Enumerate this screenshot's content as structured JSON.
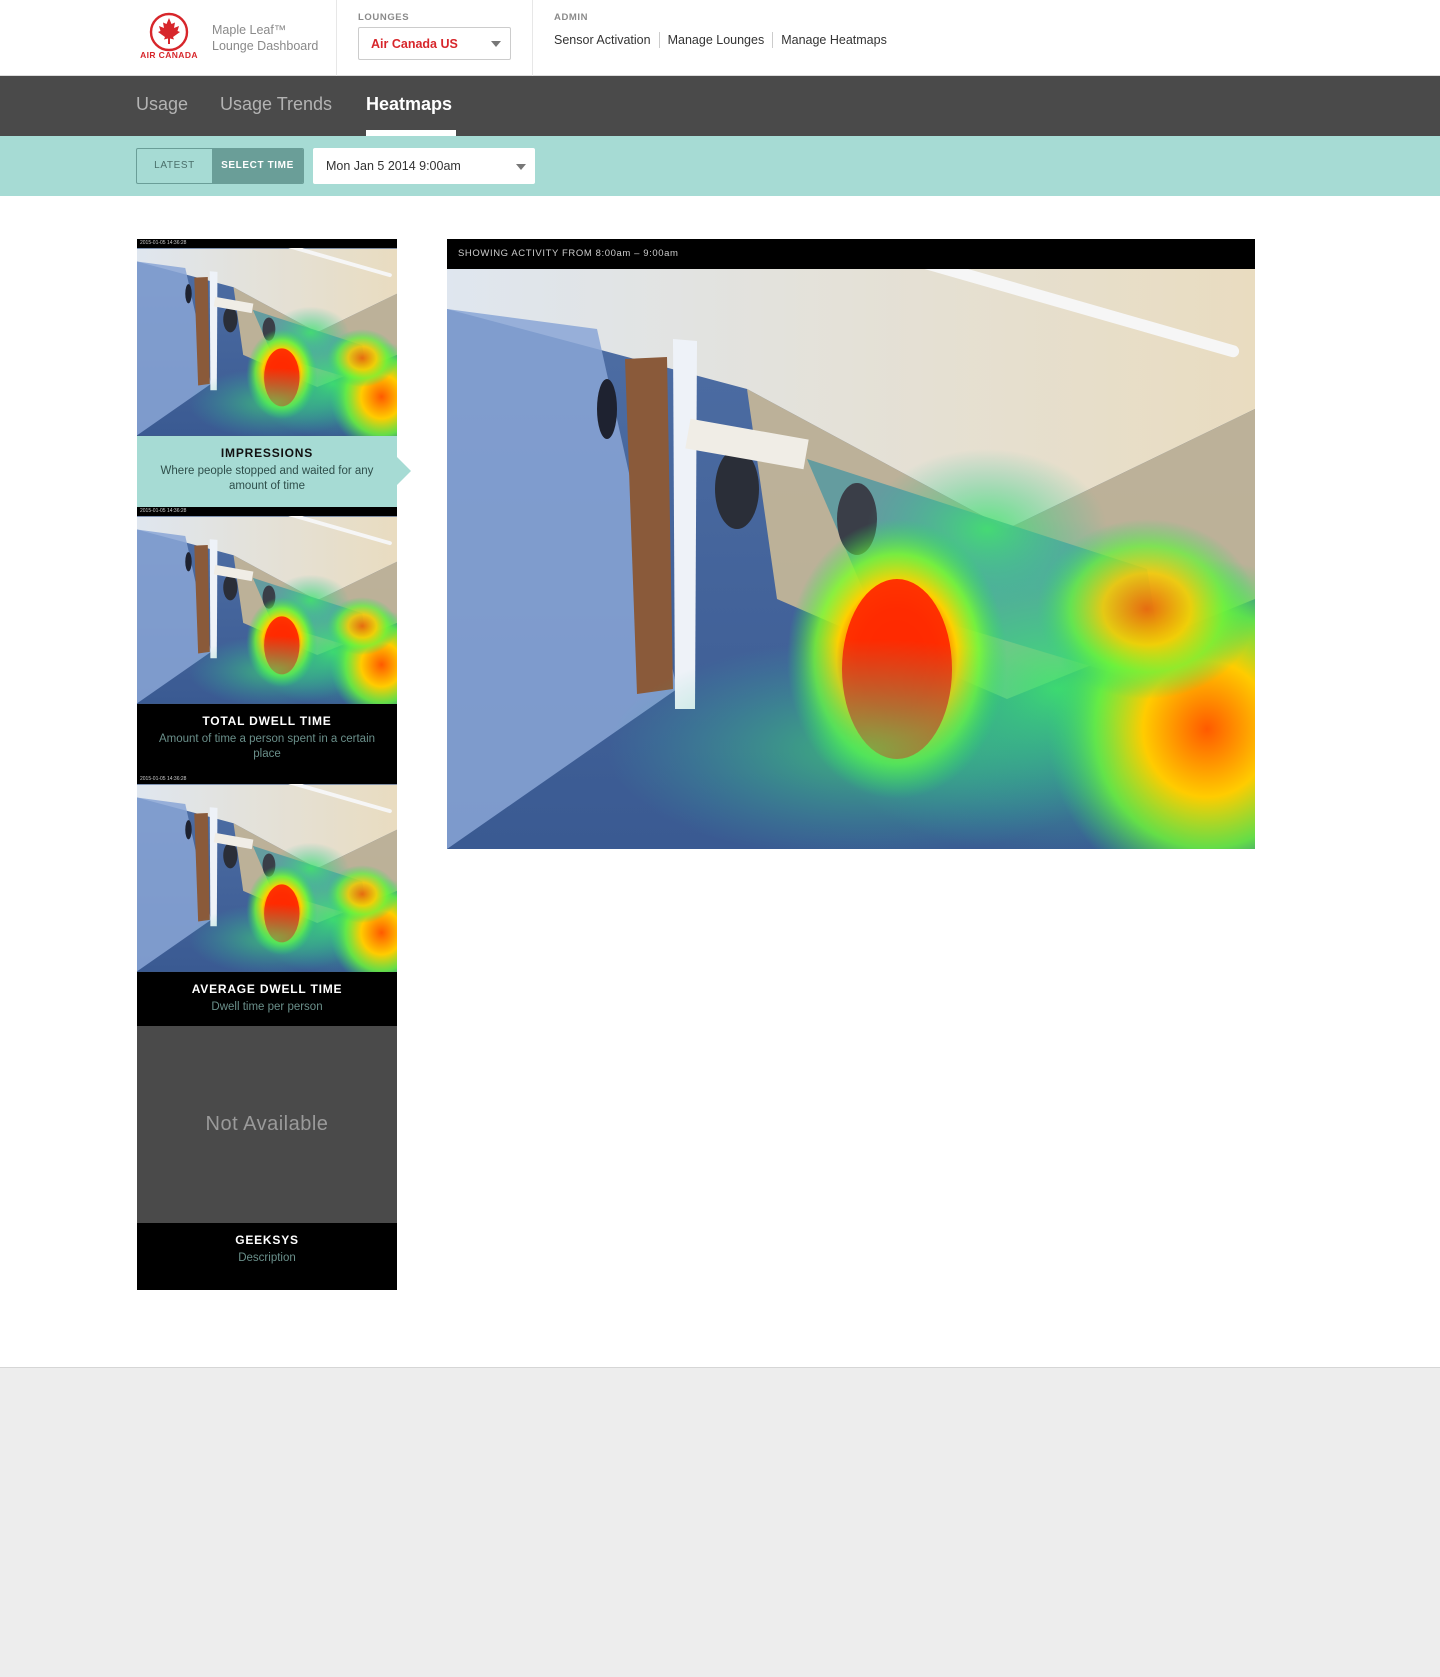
{
  "header": {
    "logo_text": "AIR CANADA",
    "brand_line1": "Maple Leaf™",
    "brand_line2": "Lounge Dashboard",
    "lounges_label": "LOUNGES",
    "lounge_selected": "Air Canada US",
    "admin_label": "ADMIN",
    "admin_links": [
      "Sensor Activation",
      "Manage Lounges",
      "Manage Heatmaps"
    ]
  },
  "nav": {
    "tabs": [
      {
        "label": "Usage",
        "active": false
      },
      {
        "label": "Usage Trends",
        "active": false
      },
      {
        "label": "Heatmaps",
        "active": true
      }
    ]
  },
  "filter": {
    "latest_label": "LATEST",
    "select_time_label": "SELECT TIME",
    "selected_time": "Mon Jan 5 2014 9:00am"
  },
  "heatmaps": [
    {
      "title": "IMPRESSIONS",
      "description": "Where people stopped and waited for any amount of time",
      "active": true
    },
    {
      "title": "TOTAL DWELL TIME",
      "description": "Amount of time a person spent in a certain place",
      "active": false
    },
    {
      "title": "AVERAGE DWELL TIME",
      "description": "Dwell time per person",
      "active": false
    },
    {
      "title": "GEEKSYS",
      "description": "Description",
      "active": false,
      "unavailable_text": "Not Available"
    }
  ],
  "thumb_timestamp": "2015-01-05 14:36:28",
  "viewer": {
    "header": "SHOWING ACTIVITY FROM 8:00am – 9:00am"
  },
  "colors": {
    "brand_red": "#d7262b",
    "nav_bg": "#4a4a4a",
    "accent_teal": "#a6dbd4",
    "toggle_active": "#6a9e98"
  }
}
